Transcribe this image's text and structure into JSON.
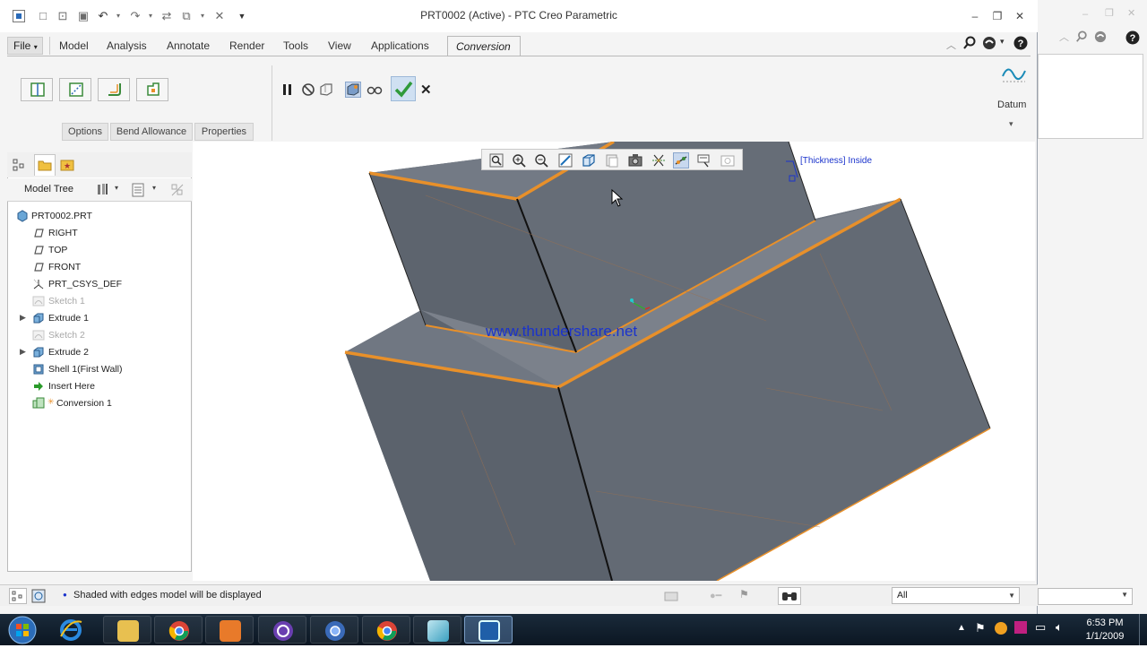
{
  "window": {
    "title": "PRT0002 (Active) - PTC Creo Parametric"
  },
  "ribbon": {
    "tabs": {
      "file": "File",
      "model": "Model",
      "analysis": "Analysis",
      "annotate": "Annotate",
      "render": "Render",
      "tools": "Tools",
      "view": "View",
      "applications": "Applications",
      "conversion": "Conversion"
    },
    "subtabs": {
      "options": "Options",
      "bend_allowance": "Bend Allowance",
      "properties": "Properties"
    },
    "datum_label": "Datum"
  },
  "model_tree": {
    "header": "Model Tree",
    "items": [
      {
        "label": "PRT0002.PRT",
        "icon": "part-icon",
        "dim": false
      },
      {
        "label": "RIGHT",
        "icon": "datum-plane-icon",
        "dim": false
      },
      {
        "label": "TOP",
        "icon": "datum-plane-icon",
        "dim": false
      },
      {
        "label": "FRONT",
        "icon": "datum-plane-icon",
        "dim": false
      },
      {
        "label": "PRT_CSYS_DEF",
        "icon": "csys-icon",
        "dim": false
      },
      {
        "label": "Sketch 1",
        "icon": "sketch-icon",
        "dim": true
      },
      {
        "label": "Extrude 1",
        "icon": "extrude-icon",
        "dim": false
      },
      {
        "label": "Sketch 2",
        "icon": "sketch-icon",
        "dim": true
      },
      {
        "label": "Extrude 2",
        "icon": "extrude-icon",
        "dim": false
      },
      {
        "label": "Shell 1(First Wall)",
        "icon": "shell-icon",
        "dim": false
      },
      {
        "label": "Insert Here",
        "icon": "insert-arrow-icon",
        "dim": false
      },
      {
        "label": "Conversion 1",
        "icon": "conversion-icon",
        "dim": false
      }
    ]
  },
  "viewport": {
    "annotation": "[Thickness] Inside",
    "watermark": "www.thundershare.net"
  },
  "status": {
    "message": "Shaded with edges model will be displayed",
    "filter": "All"
  },
  "clock": {
    "time": "6:53 PM",
    "date": "1/1/2009"
  },
  "colors": {
    "accent_orange": "#e8902a",
    "model_gray": "#5f6670",
    "ok_green": "#3fa33f",
    "watermark_blue": "#1a33cc"
  }
}
